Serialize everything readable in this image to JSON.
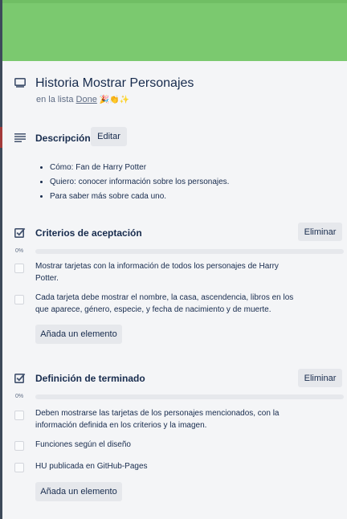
{
  "card": {
    "title": "Historia Mostrar Personajes",
    "in_list_prefix": "en la lista",
    "list_name": "Done",
    "list_emojis": "🎉👏✨"
  },
  "description": {
    "heading": "Descripción",
    "edit_label": "Editar",
    "bullets": [
      "Cómo: Fan de Harry Potter",
      "Quiero: conocer información sobre los personajes.",
      "Para saber más sobre cada uno."
    ]
  },
  "checklists": [
    {
      "title": "Criterios de aceptación",
      "delete_label": "Eliminar",
      "progress_label": "0%",
      "progress": 0,
      "items": [
        "Mostrar tarjetas con la información de todos los personajes de Harry Potter.",
        "Cada tarjeta debe mostrar el nombre, la casa, ascendencia, libros en los que aparece, género, especie, y fecha de nacimiento y de muerte."
      ],
      "add_label": "Añada un elemento"
    },
    {
      "title": "Definición de terminado",
      "delete_label": "Eliminar",
      "progress_label": "0%",
      "progress": 0,
      "items": [
        "Deben mostrarse las tarjetas de los personajes mencionados, con la información definida en los criterios y la imagen.",
        "Funciones según el diseño",
        "HU publicada en GitHub-Pages"
      ],
      "add_label": "Añada un elemento"
    }
  ],
  "colors": {
    "cover": "#7bc96f",
    "background": "#f4f5f7",
    "button": "#e6e8ec",
    "text": "#172b4d",
    "muted": "#5e6c84"
  }
}
